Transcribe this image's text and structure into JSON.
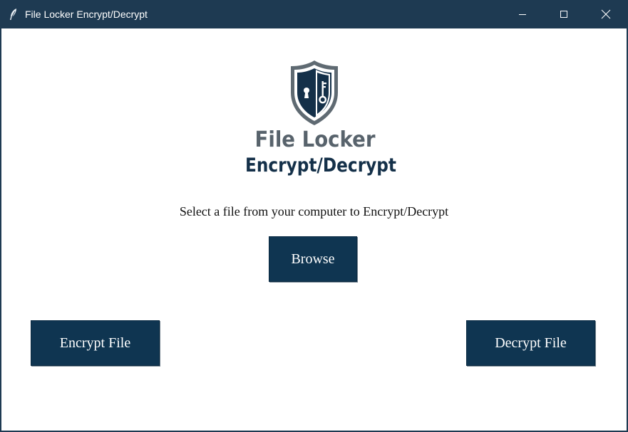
{
  "window": {
    "title": "File Locker Encrypt/Decrypt",
    "colors": {
      "titlebar": "#1e3a52",
      "button": "#0f3551",
      "logo_gray": "#58636c",
      "logo_navy": "#143049"
    },
    "controls": {
      "minimize_icon": "minimize-icon",
      "maximize_icon": "maximize-icon",
      "close_icon": "close-icon"
    }
  },
  "logo": {
    "icon": "shield-keyhole-key-icon",
    "title": "File Locker",
    "subtitle": "Encrypt/Decrypt"
  },
  "main": {
    "prompt": "Select a file from your computer to Encrypt/Decrypt",
    "browse_label": "Browse",
    "encrypt_label": "Encrypt File",
    "decrypt_label": "Decrypt File"
  }
}
